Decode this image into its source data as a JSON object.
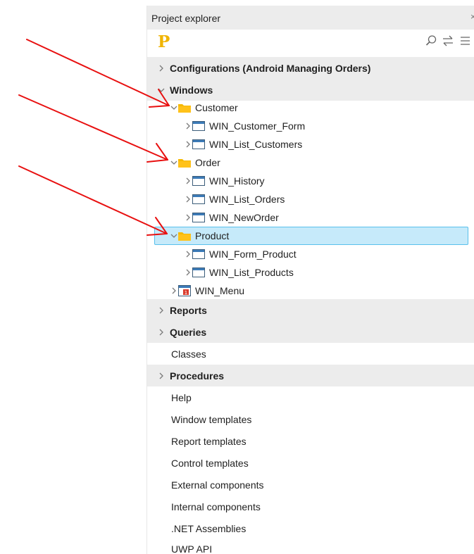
{
  "panel": {
    "title": "Project explorer",
    "close_glyph": "×"
  },
  "toolbar": {
    "logo": "P",
    "icons": [
      "search-icon",
      "synchronize-icon",
      "menu-icon"
    ]
  },
  "tree": {
    "configurations": "Configurations (Android Managing Orders)",
    "windows": "Windows",
    "customer": "Customer",
    "win_customer_form": "WIN_Customer_Form",
    "win_list_customers": "WIN_List_Customers",
    "order": "Order",
    "win_history": "WIN_History",
    "win_list_orders": "WIN_List_Orders",
    "win_neworder": "WIN_NewOrder",
    "product": "Product",
    "win_form_product": "WIN_Form_Product",
    "win_list_products": "WIN_List_Products",
    "win_menu": "WIN_Menu",
    "reports": "Reports",
    "queries": "Queries",
    "classes": "Classes",
    "procedures": "Procedures",
    "help": "Help",
    "window_templates": "Window templates",
    "report_templates": "Report templates",
    "control_templates": "Control templates",
    "external_components": "External components",
    "internal_components": "Internal components",
    "net_assemblies": ".NET Assemblies",
    "uwp_api": "UWP API"
  },
  "colors": {
    "annotation_arrow": "#e81010",
    "folder": "#f5b800",
    "selection_bg": "#c6eafa",
    "selection_border": "#58c0ec",
    "category_bg": "#ececec"
  }
}
